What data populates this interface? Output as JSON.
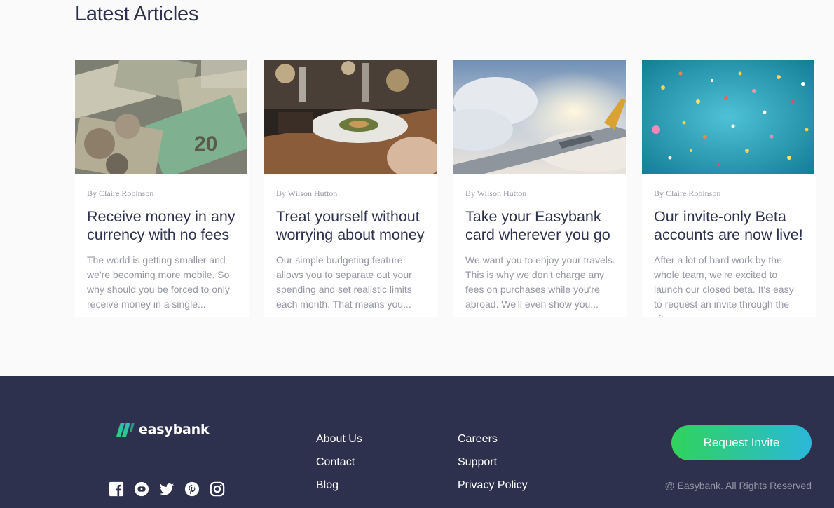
{
  "articles": {
    "title": "Latest Articles",
    "items": [
      {
        "author": "By Claire Robinson",
        "title": "Receive money in any currency with no fees",
        "excerpt": "The world is getting smaller and we're becoming more mobile. So why should you be forced to only receive money in a single..."
      },
      {
        "author": "By Wilson Hutton",
        "title": "Treat yourself without worrying about money",
        "excerpt": "Our simple budgeting feature allows you to separate out your spending and set realistic limits each month. That means you..."
      },
      {
        "author": "By Wilson Hutton",
        "title": "Take your Easybank card wherever you go",
        "excerpt": "We want you to enjoy your travels. This is why we don't charge any fees on purchases while you're abroad. We'll even show you..."
      },
      {
        "author": "By Claire Robinson",
        "title": "Our invite-only Beta accounts are now live!",
        "excerpt": "After a lot of hard work by the whole team, we're excited to launch our closed beta. It's easy to request an invite through the site..."
      }
    ]
  },
  "footer": {
    "logo": "easybank",
    "links_col1": [
      "About Us",
      "Contact",
      "Blog"
    ],
    "links_col2": [
      "Careers",
      "Support",
      "Privacy Policy"
    ],
    "cta_label": "Request Invite",
    "copyright": "@ Easybank. All Rights Reserved",
    "socials": [
      "facebook-icon",
      "youtube-icon",
      "twitter-icon",
      "pinterest-icon",
      "instagram-icon"
    ]
  },
  "colors": {
    "dark_blue": "#2d314d",
    "grayish_blue": "#9597a4",
    "lime_green": "#31d35c",
    "bright_cyan": "#2bb7da",
    "light_bg": "#fafafa"
  }
}
